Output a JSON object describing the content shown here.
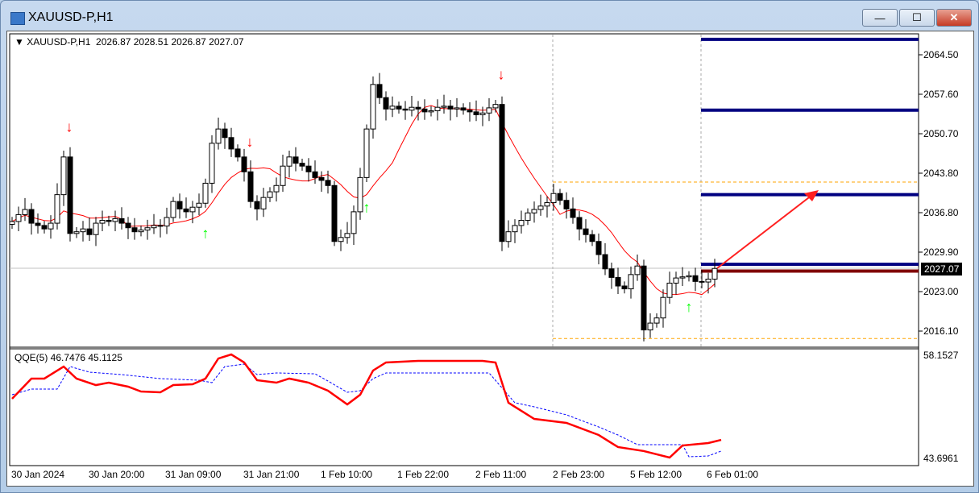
{
  "window": {
    "title": "XAUUSD-P,H1",
    "minimize": "—",
    "maximize": "☐",
    "close": "✕"
  },
  "header": {
    "symbol": "XAUUSD-P,H1",
    "ohlc": "2026.87 2028.51 2026.87 2027.07"
  },
  "indicator": {
    "label": "QQE(5) 46.7476 45.1125",
    "ymax_label": "58.1527",
    "ymin_label": "43.6961"
  },
  "price_axis": {
    "labels": [
      "2064.50",
      "2057.60",
      "2050.70",
      "2043.80",
      "2036.80",
      "2029.90",
      "2023.00",
      "2016.10"
    ],
    "current": "2027.07"
  },
  "time_axis": {
    "labels": [
      "30 Jan 2024",
      "30 Jan 20:00",
      "31 Jan 09:00",
      "31 Jan 21:00",
      "1 Feb 10:00",
      "1 Feb 22:00",
      "2 Feb 11:00",
      "2 Feb 23:00",
      "5 Feb 12:00",
      "6 Feb 01:00"
    ]
  },
  "colors": {
    "bull": "#ffffff",
    "bear": "#000000",
    "ma": "#ff0000",
    "qqe_fast": "#ff0000",
    "qqe_slow": "#0000ff",
    "levels": "#000080",
    "stop": "#800000",
    "range": "#ffa500",
    "arrow_up": "#00ff00",
    "arrow_down": "#ff0000"
  },
  "chart_data": {
    "type": "candlestick",
    "timeframe": "H1",
    "ylim": [
      2013,
      2070
    ],
    "closes": [
      2035.3,
      2036.5,
      2037.4,
      2035,
      2034.6,
      2034,
      2035,
      2040,
      2046.6,
      2033.2,
      2033.5,
      2034,
      2033,
      2035,
      2035.5,
      2035.3,
      2035.8,
      2035,
      2034.2,
      2033.5,
      2033.8,
      2034.2,
      2034.6,
      2034.5,
      2036,
      2038.8,
      2037.5,
      2037,
      2037.8,
      2038.5,
      2042,
      2049,
      2051.5,
      2050,
      2048,
      2046.6,
      2044,
      2038.8,
      2037.5,
      2039.5,
      2040.5,
      2041.6,
      2045,
      2046.6,
      2045.5,
      2045,
      2044,
      2043,
      2042.5,
      2041.6,
      2031.8,
      2032.5,
      2033.2,
      2037,
      2043,
      2051.5,
      2059.3,
      2057,
      2055,
      2055.5,
      2055,
      2054.8,
      2055.3,
      2055,
      2054.5,
      2054.7,
      2055.3,
      2055.5,
      2055,
      2055.2,
      2054.8,
      2054.5,
      2054,
      2054.3,
      2055.2,
      2055.8,
      2031.8,
      2033.5,
      2034.6,
      2035.5,
      2036.8,
      2037.4,
      2038,
      2038.6,
      2040.2,
      2039,
      2037.5,
      2036,
      2034,
      2033,
      2031.8,
      2029.5,
      2027,
      2025.5,
      2024,
      2023.5,
      2026,
      2027.5,
      2016.3,
      2017.5,
      2018.4,
      2022,
      2024.5,
      2025.4,
      2025.6,
      2025.8,
      2024.8,
      2024.7,
      2025.2,
      2027.07
    ],
    "signals_down": [
      9,
      37,
      76
    ],
    "signals_up": [
      30,
      55,
      105
    ],
    "levels": [
      2067.2,
      2054.8,
      2040.0,
      2027.8
    ],
    "stop_level": 2026.9,
    "range_high": 2042.2,
    "range_low": 2014.8,
    "qqe": {
      "ylim": [
        43.6961,
        58.1527
      ],
      "fast": [
        [
          0,
          52.05
        ],
        [
          3,
          54.88
        ],
        [
          5,
          54.88
        ],
        [
          8,
          56.57
        ],
        [
          10,
          54.88
        ],
        [
          13,
          53.97
        ],
        [
          15,
          54.31
        ],
        [
          18,
          53.75
        ],
        [
          20,
          53.07
        ],
        [
          23,
          52.96
        ],
        [
          25,
          53.97
        ],
        [
          28,
          54.09
        ],
        [
          30,
          54.88
        ],
        [
          32,
          57.7
        ],
        [
          34,
          58.26
        ],
        [
          36,
          57.14
        ],
        [
          38,
          54.65
        ],
        [
          41,
          54.31
        ],
        [
          43,
          54.88
        ],
        [
          46,
          54.31
        ],
        [
          49,
          53.18
        ],
        [
          52,
          51.26
        ],
        [
          54,
          52.62
        ],
        [
          56,
          56.01
        ],
        [
          58,
          57.14
        ],
        [
          63,
          57.36
        ],
        [
          73,
          57.36
        ],
        [
          75,
          57.14
        ],
        [
          77,
          51.49
        ],
        [
          81,
          49.23
        ],
        [
          86,
          48.67
        ],
        [
          91,
          46.97
        ],
        [
          94,
          45.28
        ],
        [
          98,
          44.72
        ],
        [
          102,
          43.81
        ],
        [
          104,
          45.5
        ],
        [
          108,
          45.84
        ],
        [
          110,
          46.29
        ]
      ],
      "slow": [
        [
          0,
          52.62
        ],
        [
          3,
          53.41
        ],
        [
          7,
          53.41
        ],
        [
          9,
          56.57
        ],
        [
          12,
          55.78
        ],
        [
          17,
          55.44
        ],
        [
          23,
          54.88
        ],
        [
          29,
          54.65
        ],
        [
          31,
          54.31
        ],
        [
          33,
          56.57
        ],
        [
          36,
          56.91
        ],
        [
          38,
          55.44
        ],
        [
          41,
          55.67
        ],
        [
          47,
          55.55
        ],
        [
          49,
          54.54
        ],
        [
          52,
          52.96
        ],
        [
          54,
          53.18
        ],
        [
          56,
          54.88
        ],
        [
          58,
          55.67
        ],
        [
          74,
          55.67
        ],
        [
          78,
          51.49
        ],
        [
          81,
          50.92
        ],
        [
          86,
          49.8
        ],
        [
          91,
          48.1
        ],
        [
          94,
          46.97
        ],
        [
          97,
          45.62
        ],
        [
          104,
          45.62
        ],
        [
          105,
          43.92
        ],
        [
          108,
          44.03
        ],
        [
          110,
          44.72
        ]
      ]
    }
  }
}
